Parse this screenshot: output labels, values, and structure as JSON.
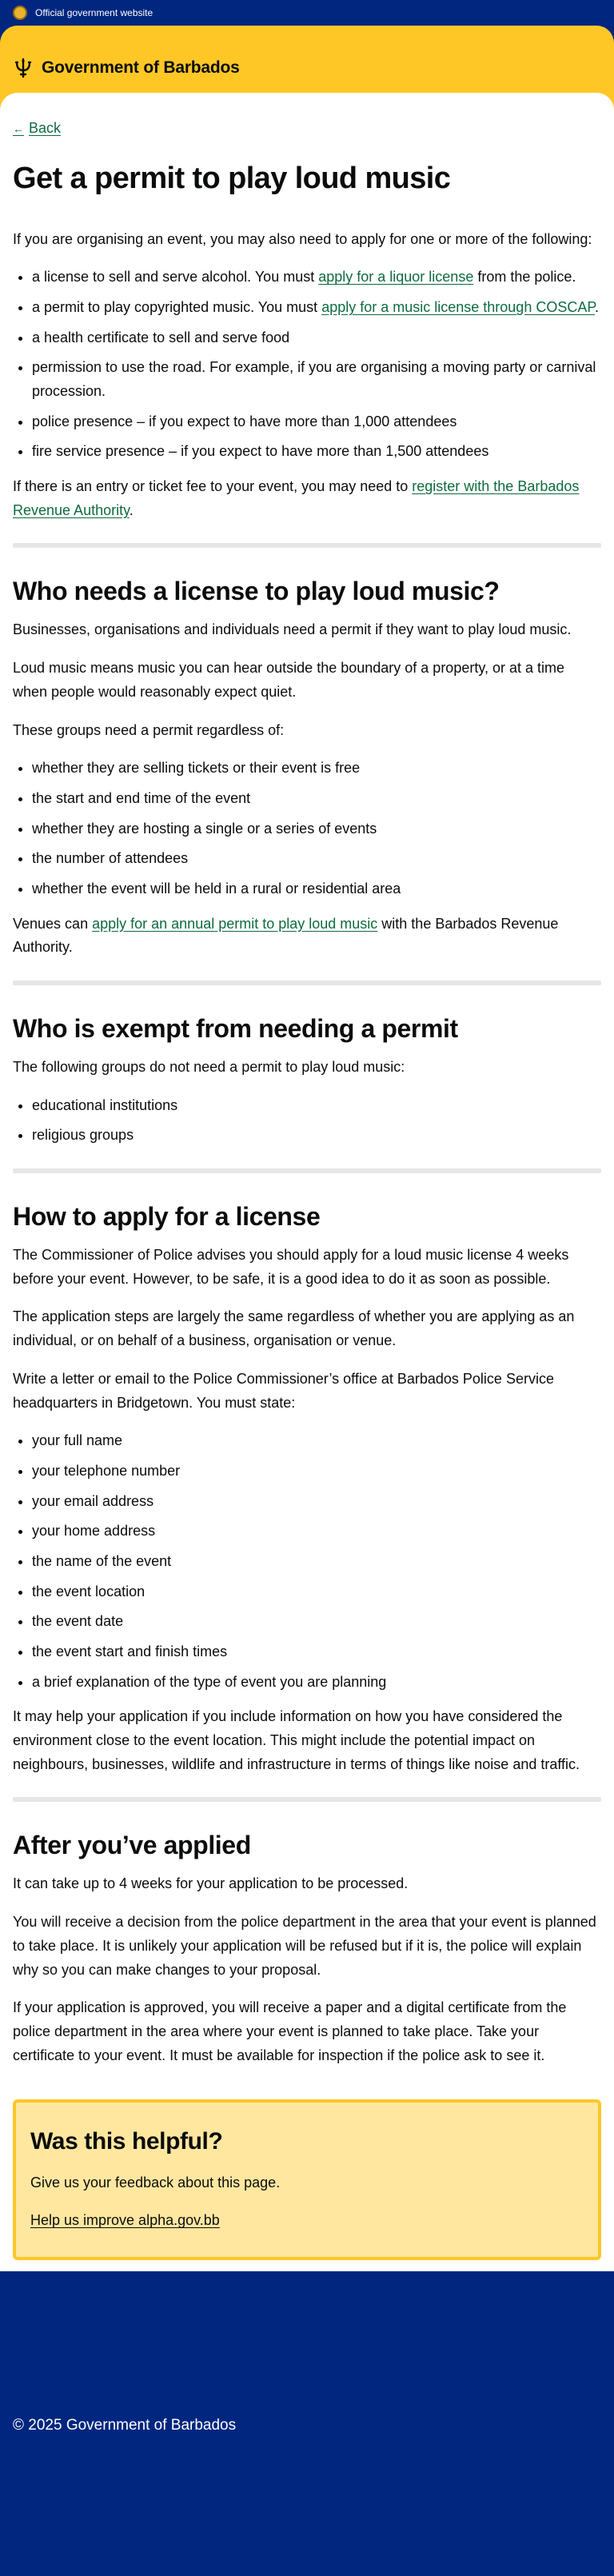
{
  "topbar": {
    "label": "Official government website"
  },
  "header": {
    "brand": "Government of Barbados"
  },
  "back": {
    "label": "Back"
  },
  "page_title": "Get a permit to play loud music",
  "intro": {
    "lead": "If you are organising an event, you may also need to apply for one or more of the following:",
    "items": [
      {
        "before": "a license to sell and serve alcohol. You must ",
        "link": "apply for a liquor license",
        "after": " from the police."
      },
      {
        "before": "a permit to play copyrighted music. You must ",
        "link": "apply for a music license through COSCAP",
        "after": "."
      },
      {
        "before": "a health certificate to sell and serve food",
        "link": "",
        "after": ""
      },
      {
        "before": "permission to use the road. For example, if you are organising a moving party or carnival procession.",
        "link": "",
        "after": ""
      },
      {
        "before": "police presence – if you expect to have more than 1,000 attendees",
        "link": "",
        "after": ""
      },
      {
        "before": "fire service presence –  if you expect to have more than 1,500 attendees",
        "link": "",
        "after": ""
      }
    ],
    "fee_before": "If there is an entry or ticket fee to your event, you may need to ",
    "fee_link": "register with the Barbados Revenue Authority",
    "fee_after": "."
  },
  "who_needs": {
    "heading": "Who needs a license to play loud music?",
    "p1": "Businesses, organisations and individuals need a permit if they want to play loud music.",
    "p2": "Loud music means music you can hear outside the boundary of a property, or at a time when people would reasonably expect quiet.",
    "p3": "These groups need a permit regardless of:",
    "items": [
      "whether they are selling tickets or their event is free",
      "the start and end time of the event",
      "whether they are hosting a single or a series of events",
      "the number of attendees",
      "whether the event will be held in a rural or residential area"
    ],
    "venues_before": "Venues can ",
    "venues_link": "apply for an annual permit to play loud music",
    "venues_after": " with the Barbados Revenue Authority."
  },
  "exempt": {
    "heading": "Who is exempt from needing a permit",
    "p1": "The following groups do not need a permit to play loud music:",
    "items": [
      "educational institutions",
      "religious groups"
    ]
  },
  "apply": {
    "heading": "How to apply for a license",
    "p1": "The Commissioner of Police advises you should apply for a loud music license 4 weeks before your event. However, to be safe, it is a good idea to do it as soon as possible.",
    "p2": "The application steps are largely the same regardless of whether you are applying as an individual, or on behalf of a business, organisation or venue.",
    "p3": "Write a letter or email to the Police Commissioner’s office at Barbados Police Service headquarters in Bridgetown. You must state:",
    "items": [
      "your full name",
      "your telephone number",
      "your email address",
      "your home address",
      "the name of the event",
      "the event location",
      "the event date",
      "the event start and finish times",
      "a brief explanation of the type of event you are planning"
    ],
    "p4": "It may help your application if you include information on how you have considered the environment close to the event location. This might include the potential impact on neighbours, businesses, wildlife and infrastructure in terms of things like noise and traffic."
  },
  "after": {
    "heading": "After you’ve applied",
    "p1": "It can take up to 4 weeks for your application to be processed.",
    "p2": "You will receive a decision from the police department in the area that your event is planned to take place. It is unlikely your application will be refused but if it is, the police will explain why so you can make changes to your proposal.",
    "p3": "If your application is approved, you will receive a paper and a digital certificate from the police department in the area where your event is planned to take place. Take your certificate to your event. It must be available for inspection if the police ask to see it."
  },
  "feedback": {
    "heading": "Was this helpful?",
    "text": "Give us your feedback about this page.",
    "link": "Help us improve alpha.gov.bb"
  },
  "footer": {
    "copyright": "© 2025 Government of Barbados"
  },
  "colors": {
    "navy": "#00267f",
    "gold": "#ffc726",
    "link": "#0e6b3f",
    "feedback_bg": "#ffe7a0"
  }
}
